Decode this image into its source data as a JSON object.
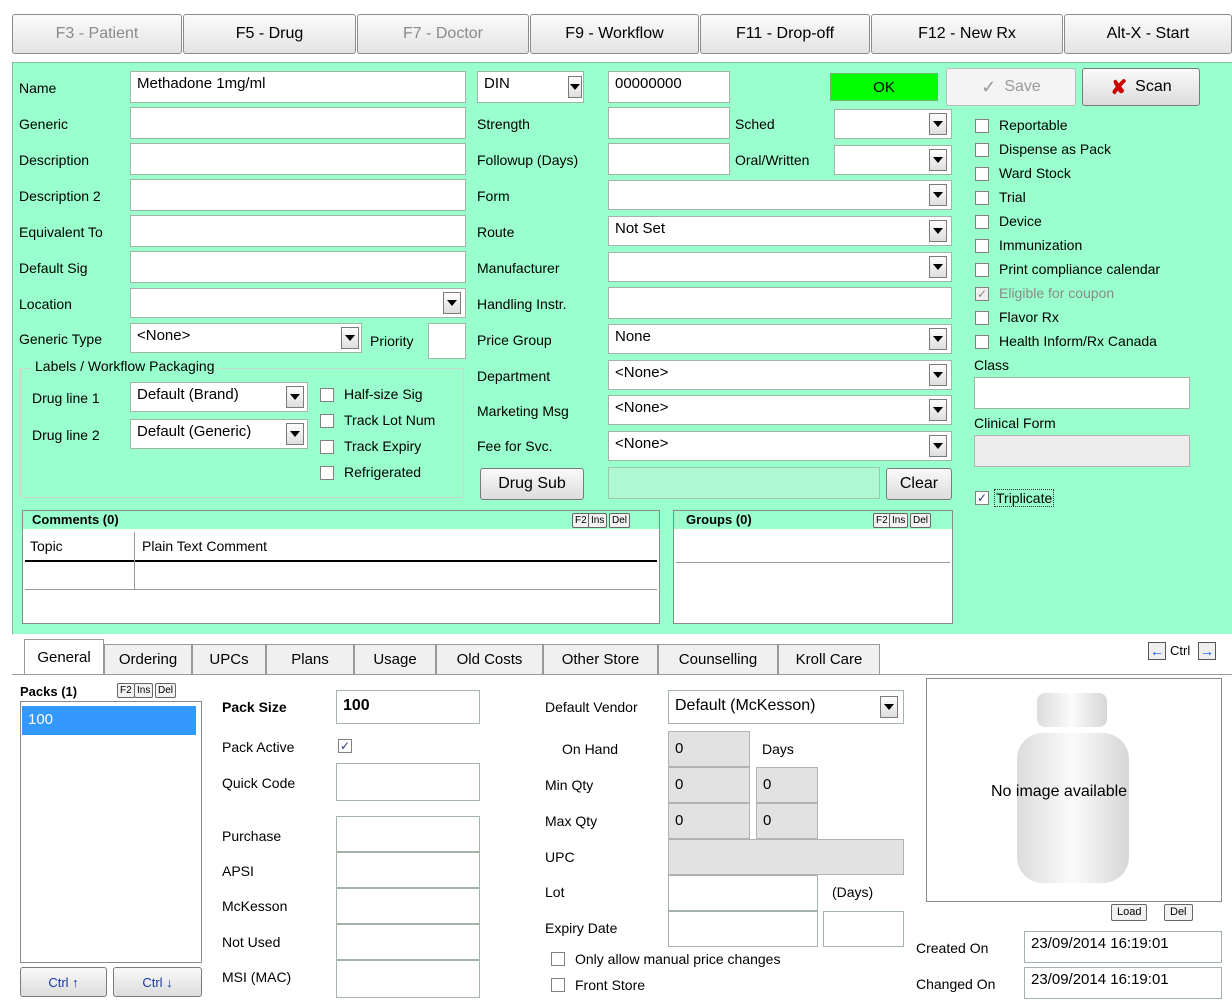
{
  "toolbar": {
    "patient": "F3 - Patient",
    "drug": "F5 - Drug",
    "doctor": "F7 - Doctor",
    "workflow": "F9 - Workflow",
    "dropoff": "F11 - Drop-off",
    "newrx": "F12 - New Rx",
    "start": "Alt-X - Start"
  },
  "form": {
    "name_label": "Name",
    "name_value": "Methadone 1mg/ml",
    "generic_label": "Generic",
    "description_label": "Description",
    "description2_label": "Description 2",
    "equivalent_label": "Equivalent To",
    "default_sig_label": "Default Sig",
    "location_label": "Location",
    "generic_type_label": "Generic Type",
    "generic_type_value": "<None>",
    "priority_label": "Priority",
    "din_type": "DIN",
    "din_value": "00000000",
    "status": "OK",
    "save_label": "Save",
    "scan_label": "Scan",
    "strength_label": "Strength",
    "sched_label": "Sched",
    "followup_label": "Followup (Days)",
    "oral_label": "Oral/Written",
    "form_label": "Form",
    "route_label": "Route",
    "route_value": "Not Set",
    "manufacturer_label": "Manufacturer",
    "handling_label": "Handling Instr.",
    "price_group_label": "Price Group",
    "price_group_value": "None",
    "department_label": "Department",
    "department_value": "<None>",
    "marketing_label": "Marketing Msg",
    "marketing_value": "<None>",
    "fee_label": "Fee for Svc.",
    "fee_value": "<None>",
    "drug_sub_label": "Drug Sub",
    "clear_label": "Clear"
  },
  "labels_group": {
    "title": "Labels / Workflow Packaging",
    "line1_label": "Drug line 1",
    "line1_value": "Default (Brand)",
    "line2_label": "Drug line 2",
    "line2_value": "Default (Generic)",
    "half_size": "Half-size Sig",
    "track_lot": "Track Lot Num",
    "track_expiry": "Track Expiry",
    "refrigerated": "Refrigerated"
  },
  "flags": [
    {
      "label": "Reportable",
      "checked": false,
      "disabled": false
    },
    {
      "label": "Dispense as Pack",
      "checked": false,
      "disabled": false
    },
    {
      "label": "Ward Stock",
      "checked": false,
      "disabled": false
    },
    {
      "label": "Trial",
      "checked": false,
      "disabled": false
    },
    {
      "label": "Device",
      "checked": false,
      "disabled": false
    },
    {
      "label": "Immunization",
      "checked": false,
      "disabled": false
    },
    {
      "label": "Print compliance calendar",
      "checked": false,
      "disabled": false
    },
    {
      "label": "Eligible for coupon",
      "checked": true,
      "disabled": true
    },
    {
      "label": "Flavor Rx",
      "checked": false,
      "disabled": false
    },
    {
      "label": "Health Inform/Rx Canada",
      "checked": false,
      "disabled": false
    }
  ],
  "class_label": "Class",
  "clinical_form_label": "Clinical Form",
  "triplicate_label": "Triplicate",
  "comments": {
    "title": "Comments (0)",
    "col_topic": "Topic",
    "col_comment": "Plain Text Comment",
    "f2": "F2",
    "ins": "Ins",
    "del": "Del"
  },
  "groups": {
    "title": "Groups (0)",
    "f2": "F2",
    "ins": "Ins",
    "del": "Del"
  },
  "tabs": [
    "General",
    "Ordering",
    "UPCs",
    "Plans",
    "Usage",
    "Old Costs",
    "Other Store",
    "Counselling",
    "Kroll Care"
  ],
  "tab_nav_label": "Ctrl",
  "packs": {
    "title": "Packs (1)",
    "items": [
      "100"
    ],
    "f2": "F2",
    "ins": "Ins",
    "del": "Del",
    "ctrl_up": "Ctrl ↑",
    "ctrl_down": "Ctrl ↓"
  },
  "general": {
    "pack_size_label": "Pack Size",
    "pack_size_value": "100",
    "pack_active_label": "Pack Active",
    "quick_code_label": "Quick Code",
    "purchase_label": "Purchase",
    "apsi_label": "APSI",
    "mckesson_label": "McKesson",
    "not_used_label": "Not Used",
    "msi_label": "MSI (MAC)",
    "vendor_label": "Default Vendor",
    "vendor_value": "Default (McKesson)",
    "on_hand_label": "On Hand",
    "on_hand_value": "0",
    "days_label": "Days",
    "min_qty_label": "Min Qty",
    "min_qty_value": "0",
    "min_qty_days": "0",
    "max_qty_label": "Max Qty",
    "max_qty_value": "0",
    "max_qty_days": "0",
    "upc_label": "UPC",
    "lot_label": "Lot",
    "days_paren": "(Days)",
    "expiry_label": "Expiry Date",
    "manual_price_label": "Only allow manual price changes",
    "front_store_label": "Front Store",
    "no_image": "No image available",
    "load_label": "Load",
    "del_label": "Del",
    "created_label": "Created On",
    "created_value": "23/09/2014 16:19:01",
    "changed_label": "Changed On",
    "changed_value": "23/09/2014 16:19:01"
  }
}
